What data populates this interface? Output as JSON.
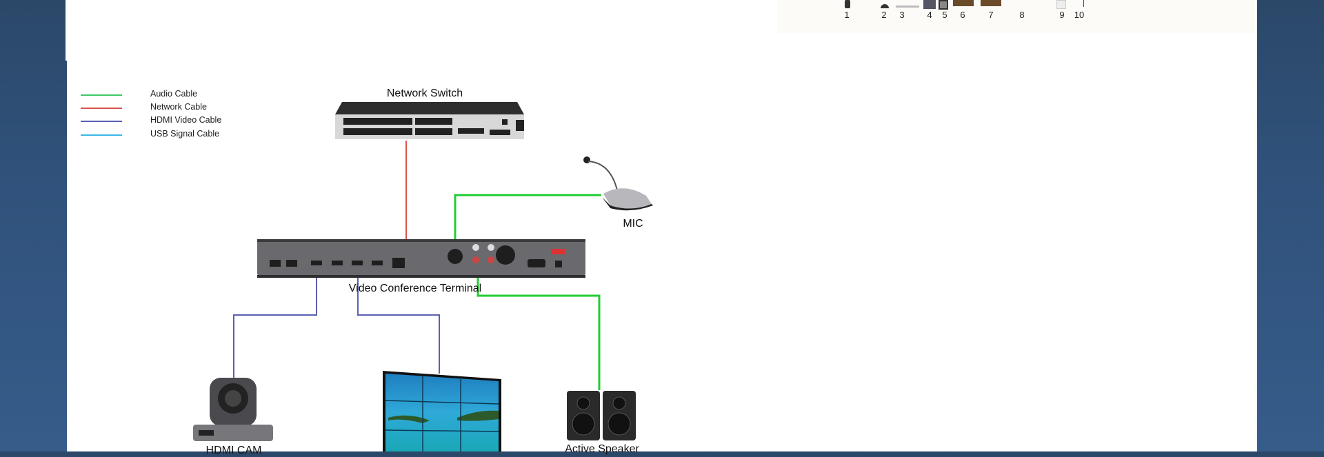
{
  "top_strip": {
    "numbers": [
      "1",
      "2",
      "3",
      "4",
      "5",
      "6",
      "7",
      "8",
      "9",
      "10"
    ]
  },
  "legend": [
    {
      "label": "Audio Cable",
      "color": "#3cc864"
    },
    {
      "label": "Network Cable",
      "color": "#d9534f"
    },
    {
      "label": "HDMI Video Cable",
      "color": "#5b5fb0"
    },
    {
      "label": "USB Signal Cable",
      "color": "#3bb6e8"
    }
  ],
  "devices": {
    "switch": "Network Switch",
    "mic": "MIC",
    "terminal": "Video Conference Terminal",
    "camera": "HDMI CAM",
    "speaker": "Active Speaker"
  },
  "colors": {
    "audio": "#22cc33",
    "network": "#d9534f",
    "hdmi": "#5b5fb0",
    "background": "#30527b"
  }
}
